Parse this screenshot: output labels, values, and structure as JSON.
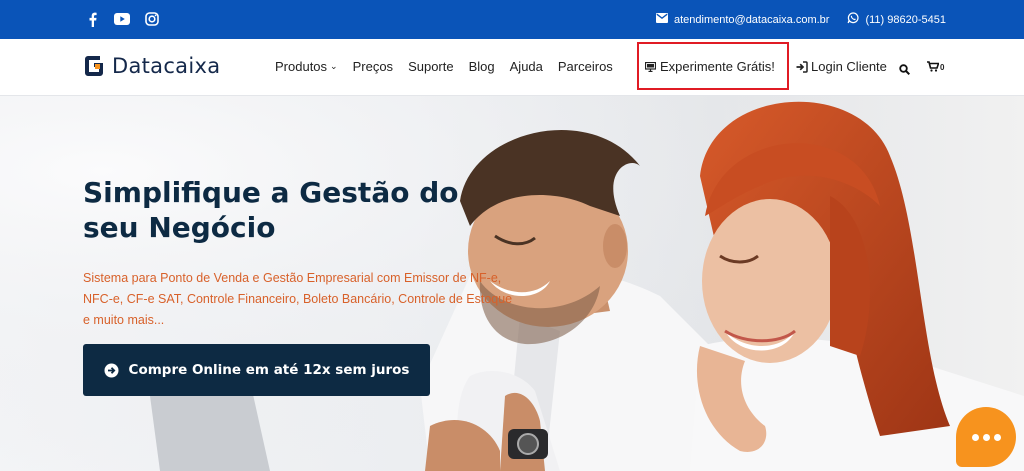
{
  "topbar": {
    "email": "atendimento@datacaixa.com.br",
    "phone": "(11) 98620-5451",
    "social_icons": [
      "facebook-icon",
      "youtube-icon",
      "instagram-icon"
    ]
  },
  "brand": {
    "name": "Datacaixa"
  },
  "nav": {
    "items": [
      "Produtos",
      "Preços",
      "Suporte",
      "Blog",
      "Ajuda",
      "Parceiros"
    ],
    "cta_label": "Experimente Grátis!",
    "login_label": "Login Cliente",
    "cart_count": "0"
  },
  "hero": {
    "headline": "Simplifique a Gestão do seu Negócio",
    "subtext": "Sistema para Ponto de Venda e Gestão Empresarial com Emissor de NF-e, NFC-e, CF-e SAT, Controle Financeiro, Boleto Bancário, Controle de Estoque e muito mais...",
    "button_label": "Compre Online em até 12x sem juros"
  },
  "colors": {
    "topbar": "#0a54b8",
    "navy": "#0d2a43",
    "accent_orange": "#d8612a",
    "highlight_red": "#e01b24",
    "chat_orange": "#f7931e"
  }
}
